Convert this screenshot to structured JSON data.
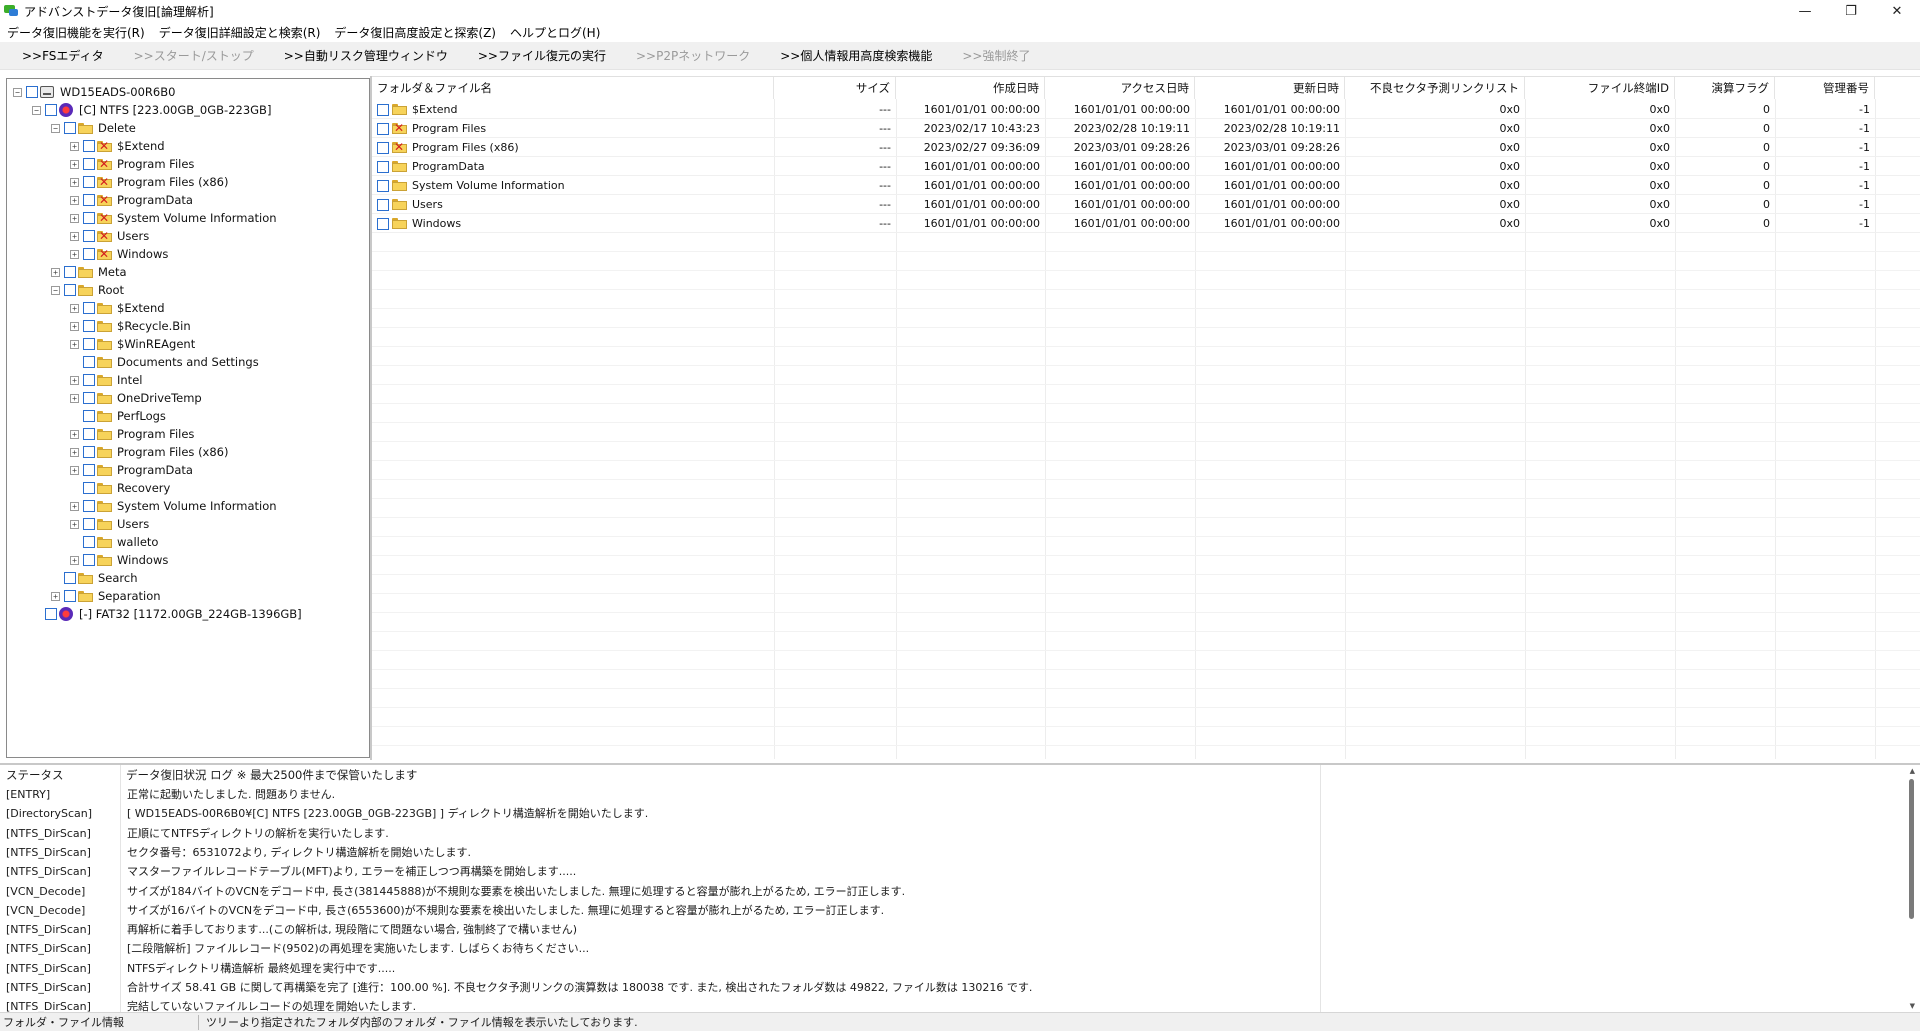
{
  "window": {
    "title": "アドバンストデータ復旧[論理解析]",
    "minimize": "—",
    "maximize": "❐",
    "close": "✕"
  },
  "menu": [
    "データ復旧機能を実行(R)",
    "データ復旧詳細設定と検索(R)",
    "データ復旧高度設定と探索(Z)",
    "ヘルプとログ(H)"
  ],
  "toolbar": [
    {
      "label": ">>FSエディタ",
      "enabled": true
    },
    {
      "label": ">>スタート/ストップ",
      "enabled": false
    },
    {
      "label": ">>自動リスク管理ウィンドウ",
      "enabled": true
    },
    {
      "label": ">>ファイル復元の実行",
      "enabled": true
    },
    {
      "label": ">>P2Pネットワーク",
      "enabled": false
    },
    {
      "label": ">>個人情報用高度検索機能",
      "enabled": true
    },
    {
      "label": ">>強制終了",
      "enabled": false
    }
  ],
  "tree": [
    {
      "label": "WD15EADS-00R6B0",
      "level": 0,
      "expander": "-",
      "icon": "drive"
    },
    {
      "label": "[C] NTFS [223.00GB_0GB-223GB]",
      "level": 1,
      "expander": "-",
      "icon": "partition"
    },
    {
      "label": "Delete",
      "level": 2,
      "expander": "-",
      "icon": "folder"
    },
    {
      "label": "$Extend",
      "level": 3,
      "expander": "+",
      "icon": "folder-deleted"
    },
    {
      "label": "Program Files",
      "level": 3,
      "expander": "+",
      "icon": "folder-deleted"
    },
    {
      "label": "Program Files (x86)",
      "level": 3,
      "expander": "+",
      "icon": "folder-deleted"
    },
    {
      "label": "ProgramData",
      "level": 3,
      "expander": "+",
      "icon": "folder-deleted"
    },
    {
      "label": "System Volume Information",
      "level": 3,
      "expander": "+",
      "icon": "folder-deleted"
    },
    {
      "label": "Users",
      "level": 3,
      "expander": "+",
      "icon": "folder-deleted"
    },
    {
      "label": "Windows",
      "level": 3,
      "expander": "+",
      "icon": "folder-deleted"
    },
    {
      "label": "Meta",
      "level": 2,
      "expander": "+",
      "icon": "folder"
    },
    {
      "label": "Root",
      "level": 2,
      "expander": "-",
      "icon": "folder"
    },
    {
      "label": "$Extend",
      "level": 3,
      "expander": "+",
      "icon": "folder"
    },
    {
      "label": "$Recycle.Bin",
      "level": 3,
      "expander": "+",
      "icon": "folder"
    },
    {
      "label": "$WinREAgent",
      "level": 3,
      "expander": "+",
      "icon": "folder"
    },
    {
      "label": "Documents and Settings",
      "level": 3,
      "expander": "",
      "icon": "folder"
    },
    {
      "label": "Intel",
      "level": 3,
      "expander": "+",
      "icon": "folder"
    },
    {
      "label": "OneDriveTemp",
      "level": 3,
      "expander": "+",
      "icon": "folder"
    },
    {
      "label": "PerfLogs",
      "level": 3,
      "expander": "",
      "icon": "folder"
    },
    {
      "label": "Program Files",
      "level": 3,
      "expander": "+",
      "icon": "folder"
    },
    {
      "label": "Program Files (x86)",
      "level": 3,
      "expander": "+",
      "icon": "folder"
    },
    {
      "label": "ProgramData",
      "level": 3,
      "expander": "+",
      "icon": "folder"
    },
    {
      "label": "Recovery",
      "level": 3,
      "expander": "",
      "icon": "folder"
    },
    {
      "label": "System Volume Information",
      "level": 3,
      "expander": "+",
      "icon": "folder"
    },
    {
      "label": "Users",
      "level": 3,
      "expander": "+",
      "icon": "folder"
    },
    {
      "label": "walleto",
      "level": 3,
      "expander": "",
      "icon": "folder"
    },
    {
      "label": "Windows",
      "level": 3,
      "expander": "+",
      "icon": "folder"
    },
    {
      "label": "Search",
      "level": 2,
      "expander": "",
      "icon": "folder"
    },
    {
      "label": "Separation",
      "level": 2,
      "expander": "+",
      "icon": "folder"
    },
    {
      "label": "[-] FAT32 [1172.00GB_224GB-1396GB]",
      "level": 1,
      "expander": "",
      "icon": "partition"
    }
  ],
  "list": {
    "columns": [
      "フォルダ＆ファイル名",
      "サイズ",
      "作成日時",
      "アクセス日時",
      "更新日時",
      "不良セクタ予測リンクリスト",
      "ファイル終端ID",
      "演算フラグ",
      "管理番号"
    ],
    "rows": [
      {
        "name": "$Extend",
        "deleted": false,
        "size": "---",
        "created": "1601/01/01 00:00:00",
        "accessed": "1601/01/01 00:00:00",
        "modified": "1601/01/01 00:00:00",
        "badsector": "0x0",
        "endid": "0x0",
        "flag": "0",
        "mgmt": "-1"
      },
      {
        "name": "Program Files",
        "deleted": true,
        "size": "---",
        "created": "2023/02/17 10:43:23",
        "accessed": "2023/02/28 10:19:11",
        "modified": "2023/02/28 10:19:11",
        "badsector": "0x0",
        "endid": "0x0",
        "flag": "0",
        "mgmt": "-1"
      },
      {
        "name": "Program Files (x86)",
        "deleted": true,
        "size": "---",
        "created": "2023/02/27 09:36:09",
        "accessed": "2023/03/01 09:28:26",
        "modified": "2023/03/01 09:28:26",
        "badsector": "0x0",
        "endid": "0x0",
        "flag": "0",
        "mgmt": "-1"
      },
      {
        "name": "ProgramData",
        "deleted": false,
        "size": "---",
        "created": "1601/01/01 00:00:00",
        "accessed": "1601/01/01 00:00:00",
        "modified": "1601/01/01 00:00:00",
        "badsector": "0x0",
        "endid": "0x0",
        "flag": "0",
        "mgmt": "-1"
      },
      {
        "name": "System Volume Information",
        "deleted": false,
        "size": "---",
        "created": "1601/01/01 00:00:00",
        "accessed": "1601/01/01 00:00:00",
        "modified": "1601/01/01 00:00:00",
        "badsector": "0x0",
        "endid": "0x0",
        "flag": "0",
        "mgmt": "-1"
      },
      {
        "name": "Users",
        "deleted": false,
        "size": "---",
        "created": "1601/01/01 00:00:00",
        "accessed": "1601/01/01 00:00:00",
        "modified": "1601/01/01 00:00:00",
        "badsector": "0x0",
        "endid": "0x0",
        "flag": "0",
        "mgmt": "-1"
      },
      {
        "name": "Windows",
        "deleted": false,
        "size": "---",
        "created": "1601/01/01 00:00:00",
        "accessed": "1601/01/01 00:00:00",
        "modified": "1601/01/01 00:00:00",
        "badsector": "0x0",
        "endid": "0x0",
        "flag": "0",
        "mgmt": "-1"
      }
    ]
  },
  "log": {
    "header_status": "ステータス",
    "header_message": "データ復旧状況 ログ ※ 最大2500件まで保管いたします",
    "rows": [
      {
        "src": "[ENTRY]",
        "msg": "正常に起動いたしました. 問題ありません."
      },
      {
        "src": "[DirectoryScan]",
        "msg": "[ WD15EADS-00R6B0¥[C] NTFS [223.00GB_0GB-223GB] ] ディレクトリ構造解析を開始いたします."
      },
      {
        "src": "[NTFS_DirScan]",
        "msg": "正順にてNTFSディレクトリの解析を実行いたします."
      },
      {
        "src": "[NTFS_DirScan]",
        "msg": "セクタ番号：6531072より, ディレクトリ構造解析を開始いたします."
      },
      {
        "src": "[NTFS_DirScan]",
        "msg": "マスターファイルレコードテーブル(MFT)より, エラーを補正しつつ再構築を開始します....."
      },
      {
        "src": "[VCN_Decode]",
        "msg": "サイズが184バイトのVCNをデコード中, 長さ(381445888)が不規則な要素を検出いたしました. 無理に処理すると容量が膨れ上がるため, エラー訂正します."
      },
      {
        "src": "[VCN_Decode]",
        "msg": "サイズが16バイトのVCNをデコード中, 長さ(6553600)が不規則な要素を検出いたしました. 無理に処理すると容量が膨れ上がるため, エラー訂正します."
      },
      {
        "src": "[NTFS_DirScan]",
        "msg": "再解析に着手しております...(この解析は, 現段階にて問題ない場合, 強制終了で構いません)"
      },
      {
        "src": "[NTFS_DirScan]",
        "msg": "[二段階解析] ファイルレコード(9502)の再処理を実施いたします. しばらくお待ちください..."
      },
      {
        "src": "[NTFS_DirScan]",
        "msg": "NTFSディレクトリ構造解析 最終処理を実行中です....."
      },
      {
        "src": "[NTFS_DirScan]",
        "msg": "合計サイズ 58.41 GB に関して再構築を完了 [進行：100.00 %]. 不良セクタ予測リンクの演算数は 180038 です. また, 検出されたフォルダ数は 49822, ファイル数は 130216 です."
      },
      {
        "src": "[NTFS_DirScan]",
        "msg": "完結していないファイルレコードの処理を開始いたします."
      }
    ]
  },
  "status": {
    "left": "フォルダ・ファイル情報",
    "right": "ツリーより指定されたフォルダ内部のフォルダ・ファイル情報を表示いたしております."
  }
}
